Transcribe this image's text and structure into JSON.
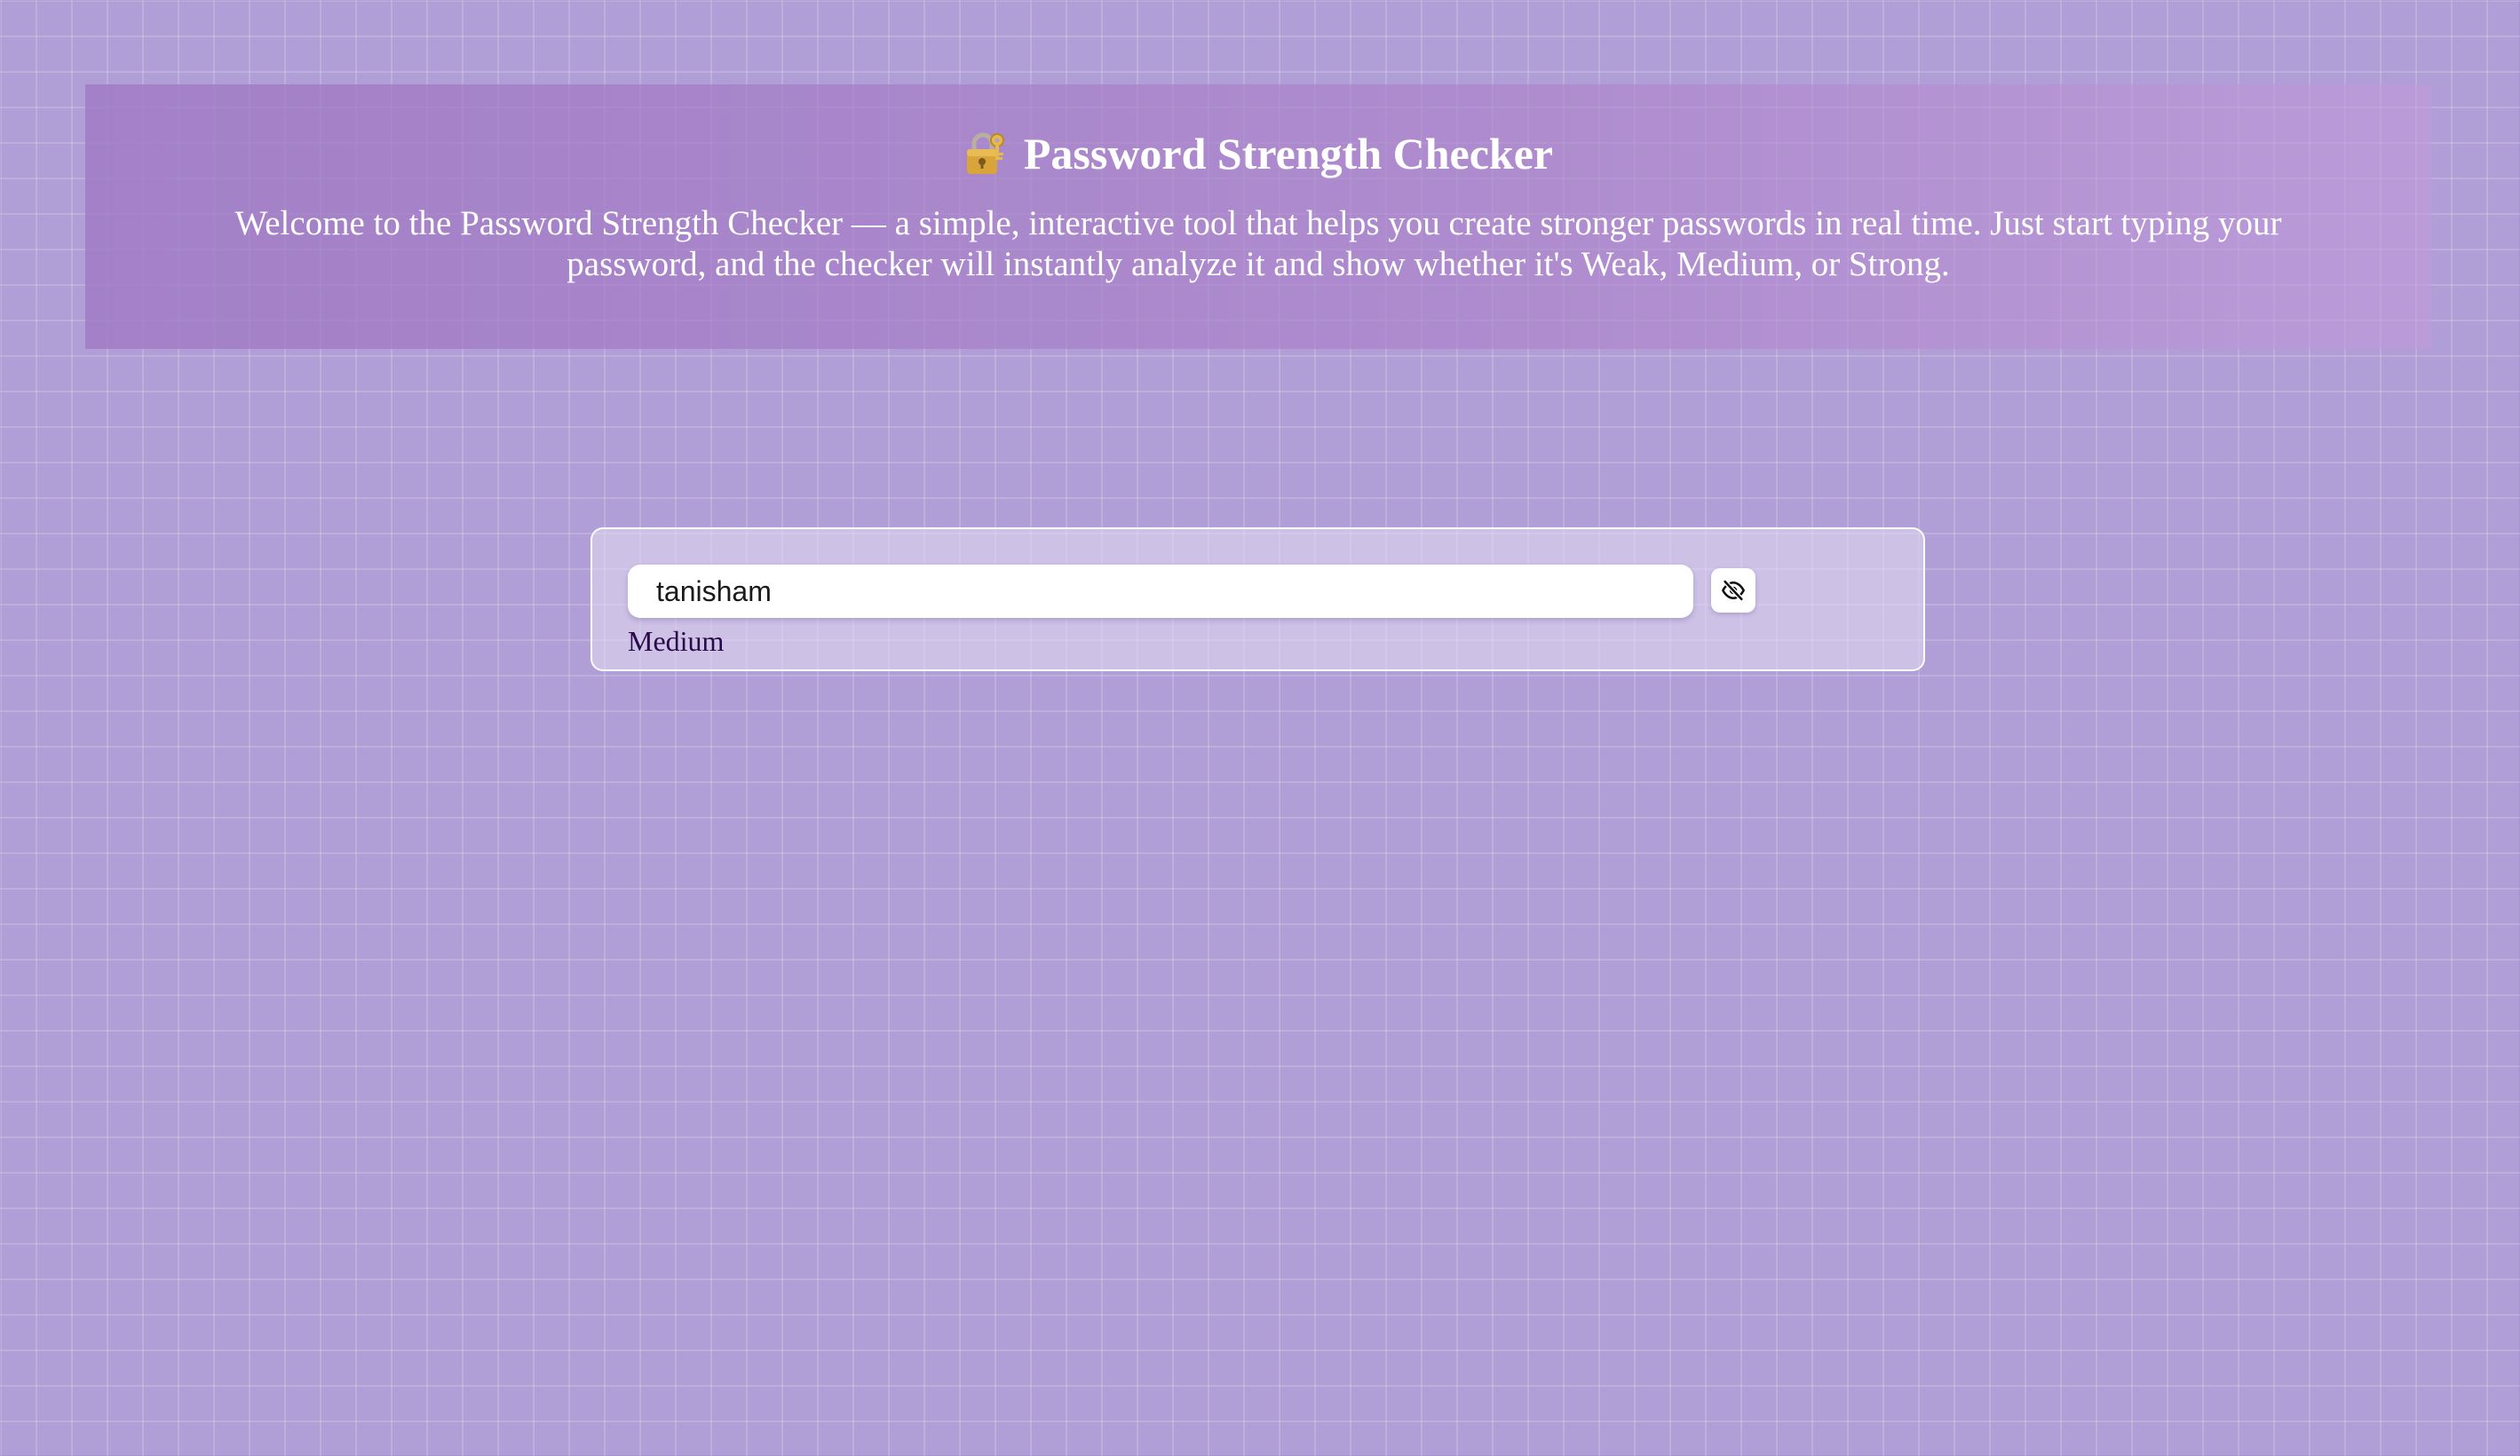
{
  "header": {
    "title_emoji": "🔐",
    "title": "Password Strength Checker",
    "intro": "Welcome to the Password Strength Checker — a simple, interactive tool that helps you create stronger passwords in real time. Just start typing your password, and the checker will instantly analyze it and show whether it's Weak, Medium, or Strong."
  },
  "checker": {
    "password_value": "tanisham",
    "toggle_icon": "eye-slash-icon",
    "strength_label": "Medium"
  },
  "colors": {
    "background": "#b09ed7",
    "header_bg": "#a57fc6",
    "strength_text": "#2a0a4a"
  }
}
